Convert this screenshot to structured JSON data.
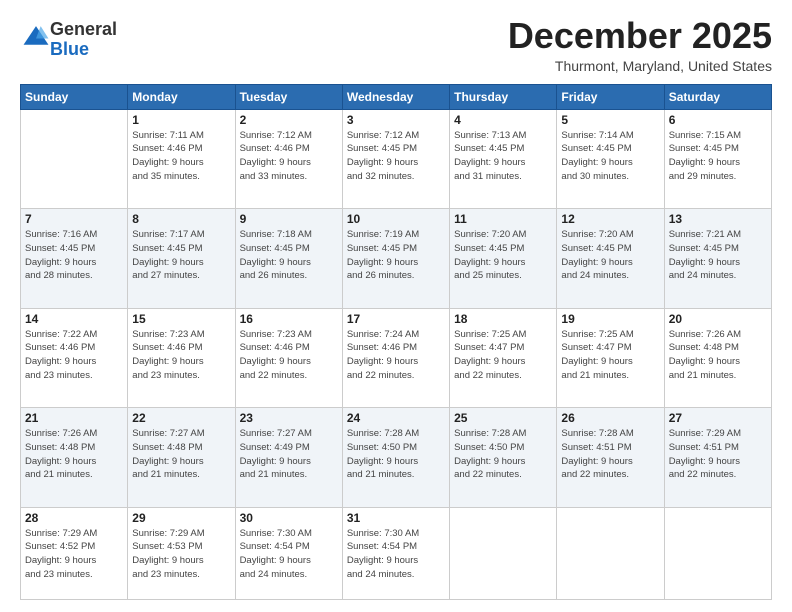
{
  "logo": {
    "general": "General",
    "blue": "Blue"
  },
  "header": {
    "month": "December 2025",
    "location": "Thurmont, Maryland, United States"
  },
  "days_of_week": [
    "Sunday",
    "Monday",
    "Tuesday",
    "Wednesday",
    "Thursday",
    "Friday",
    "Saturday"
  ],
  "weeks": [
    [
      {
        "day": "",
        "info": ""
      },
      {
        "day": "1",
        "info": "Sunrise: 7:11 AM\nSunset: 4:46 PM\nDaylight: 9 hours\nand 35 minutes."
      },
      {
        "day": "2",
        "info": "Sunrise: 7:12 AM\nSunset: 4:46 PM\nDaylight: 9 hours\nand 33 minutes."
      },
      {
        "day": "3",
        "info": "Sunrise: 7:12 AM\nSunset: 4:45 PM\nDaylight: 9 hours\nand 32 minutes."
      },
      {
        "day": "4",
        "info": "Sunrise: 7:13 AM\nSunset: 4:45 PM\nDaylight: 9 hours\nand 31 minutes."
      },
      {
        "day": "5",
        "info": "Sunrise: 7:14 AM\nSunset: 4:45 PM\nDaylight: 9 hours\nand 30 minutes."
      },
      {
        "day": "6",
        "info": "Sunrise: 7:15 AM\nSunset: 4:45 PM\nDaylight: 9 hours\nand 29 minutes."
      }
    ],
    [
      {
        "day": "7",
        "info": "Sunrise: 7:16 AM\nSunset: 4:45 PM\nDaylight: 9 hours\nand 28 minutes."
      },
      {
        "day": "8",
        "info": "Sunrise: 7:17 AM\nSunset: 4:45 PM\nDaylight: 9 hours\nand 27 minutes."
      },
      {
        "day": "9",
        "info": "Sunrise: 7:18 AM\nSunset: 4:45 PM\nDaylight: 9 hours\nand 26 minutes."
      },
      {
        "day": "10",
        "info": "Sunrise: 7:19 AM\nSunset: 4:45 PM\nDaylight: 9 hours\nand 26 minutes."
      },
      {
        "day": "11",
        "info": "Sunrise: 7:20 AM\nSunset: 4:45 PM\nDaylight: 9 hours\nand 25 minutes."
      },
      {
        "day": "12",
        "info": "Sunrise: 7:20 AM\nSunset: 4:45 PM\nDaylight: 9 hours\nand 24 minutes."
      },
      {
        "day": "13",
        "info": "Sunrise: 7:21 AM\nSunset: 4:45 PM\nDaylight: 9 hours\nand 24 minutes."
      }
    ],
    [
      {
        "day": "14",
        "info": "Sunrise: 7:22 AM\nSunset: 4:46 PM\nDaylight: 9 hours\nand 23 minutes."
      },
      {
        "day": "15",
        "info": "Sunrise: 7:23 AM\nSunset: 4:46 PM\nDaylight: 9 hours\nand 23 minutes."
      },
      {
        "day": "16",
        "info": "Sunrise: 7:23 AM\nSunset: 4:46 PM\nDaylight: 9 hours\nand 22 minutes."
      },
      {
        "day": "17",
        "info": "Sunrise: 7:24 AM\nSunset: 4:46 PM\nDaylight: 9 hours\nand 22 minutes."
      },
      {
        "day": "18",
        "info": "Sunrise: 7:25 AM\nSunset: 4:47 PM\nDaylight: 9 hours\nand 22 minutes."
      },
      {
        "day": "19",
        "info": "Sunrise: 7:25 AM\nSunset: 4:47 PM\nDaylight: 9 hours\nand 21 minutes."
      },
      {
        "day": "20",
        "info": "Sunrise: 7:26 AM\nSunset: 4:48 PM\nDaylight: 9 hours\nand 21 minutes."
      }
    ],
    [
      {
        "day": "21",
        "info": "Sunrise: 7:26 AM\nSunset: 4:48 PM\nDaylight: 9 hours\nand 21 minutes."
      },
      {
        "day": "22",
        "info": "Sunrise: 7:27 AM\nSunset: 4:48 PM\nDaylight: 9 hours\nand 21 minutes."
      },
      {
        "day": "23",
        "info": "Sunrise: 7:27 AM\nSunset: 4:49 PM\nDaylight: 9 hours\nand 21 minutes."
      },
      {
        "day": "24",
        "info": "Sunrise: 7:28 AM\nSunset: 4:50 PM\nDaylight: 9 hours\nand 21 minutes."
      },
      {
        "day": "25",
        "info": "Sunrise: 7:28 AM\nSunset: 4:50 PM\nDaylight: 9 hours\nand 22 minutes."
      },
      {
        "day": "26",
        "info": "Sunrise: 7:28 AM\nSunset: 4:51 PM\nDaylight: 9 hours\nand 22 minutes."
      },
      {
        "day": "27",
        "info": "Sunrise: 7:29 AM\nSunset: 4:51 PM\nDaylight: 9 hours\nand 22 minutes."
      }
    ],
    [
      {
        "day": "28",
        "info": "Sunrise: 7:29 AM\nSunset: 4:52 PM\nDaylight: 9 hours\nand 23 minutes."
      },
      {
        "day": "29",
        "info": "Sunrise: 7:29 AM\nSunset: 4:53 PM\nDaylight: 9 hours\nand 23 minutes."
      },
      {
        "day": "30",
        "info": "Sunrise: 7:30 AM\nSunset: 4:54 PM\nDaylight: 9 hours\nand 24 minutes."
      },
      {
        "day": "31",
        "info": "Sunrise: 7:30 AM\nSunset: 4:54 PM\nDaylight: 9 hours\nand 24 minutes."
      },
      {
        "day": "",
        "info": ""
      },
      {
        "day": "",
        "info": ""
      },
      {
        "day": "",
        "info": ""
      }
    ]
  ]
}
